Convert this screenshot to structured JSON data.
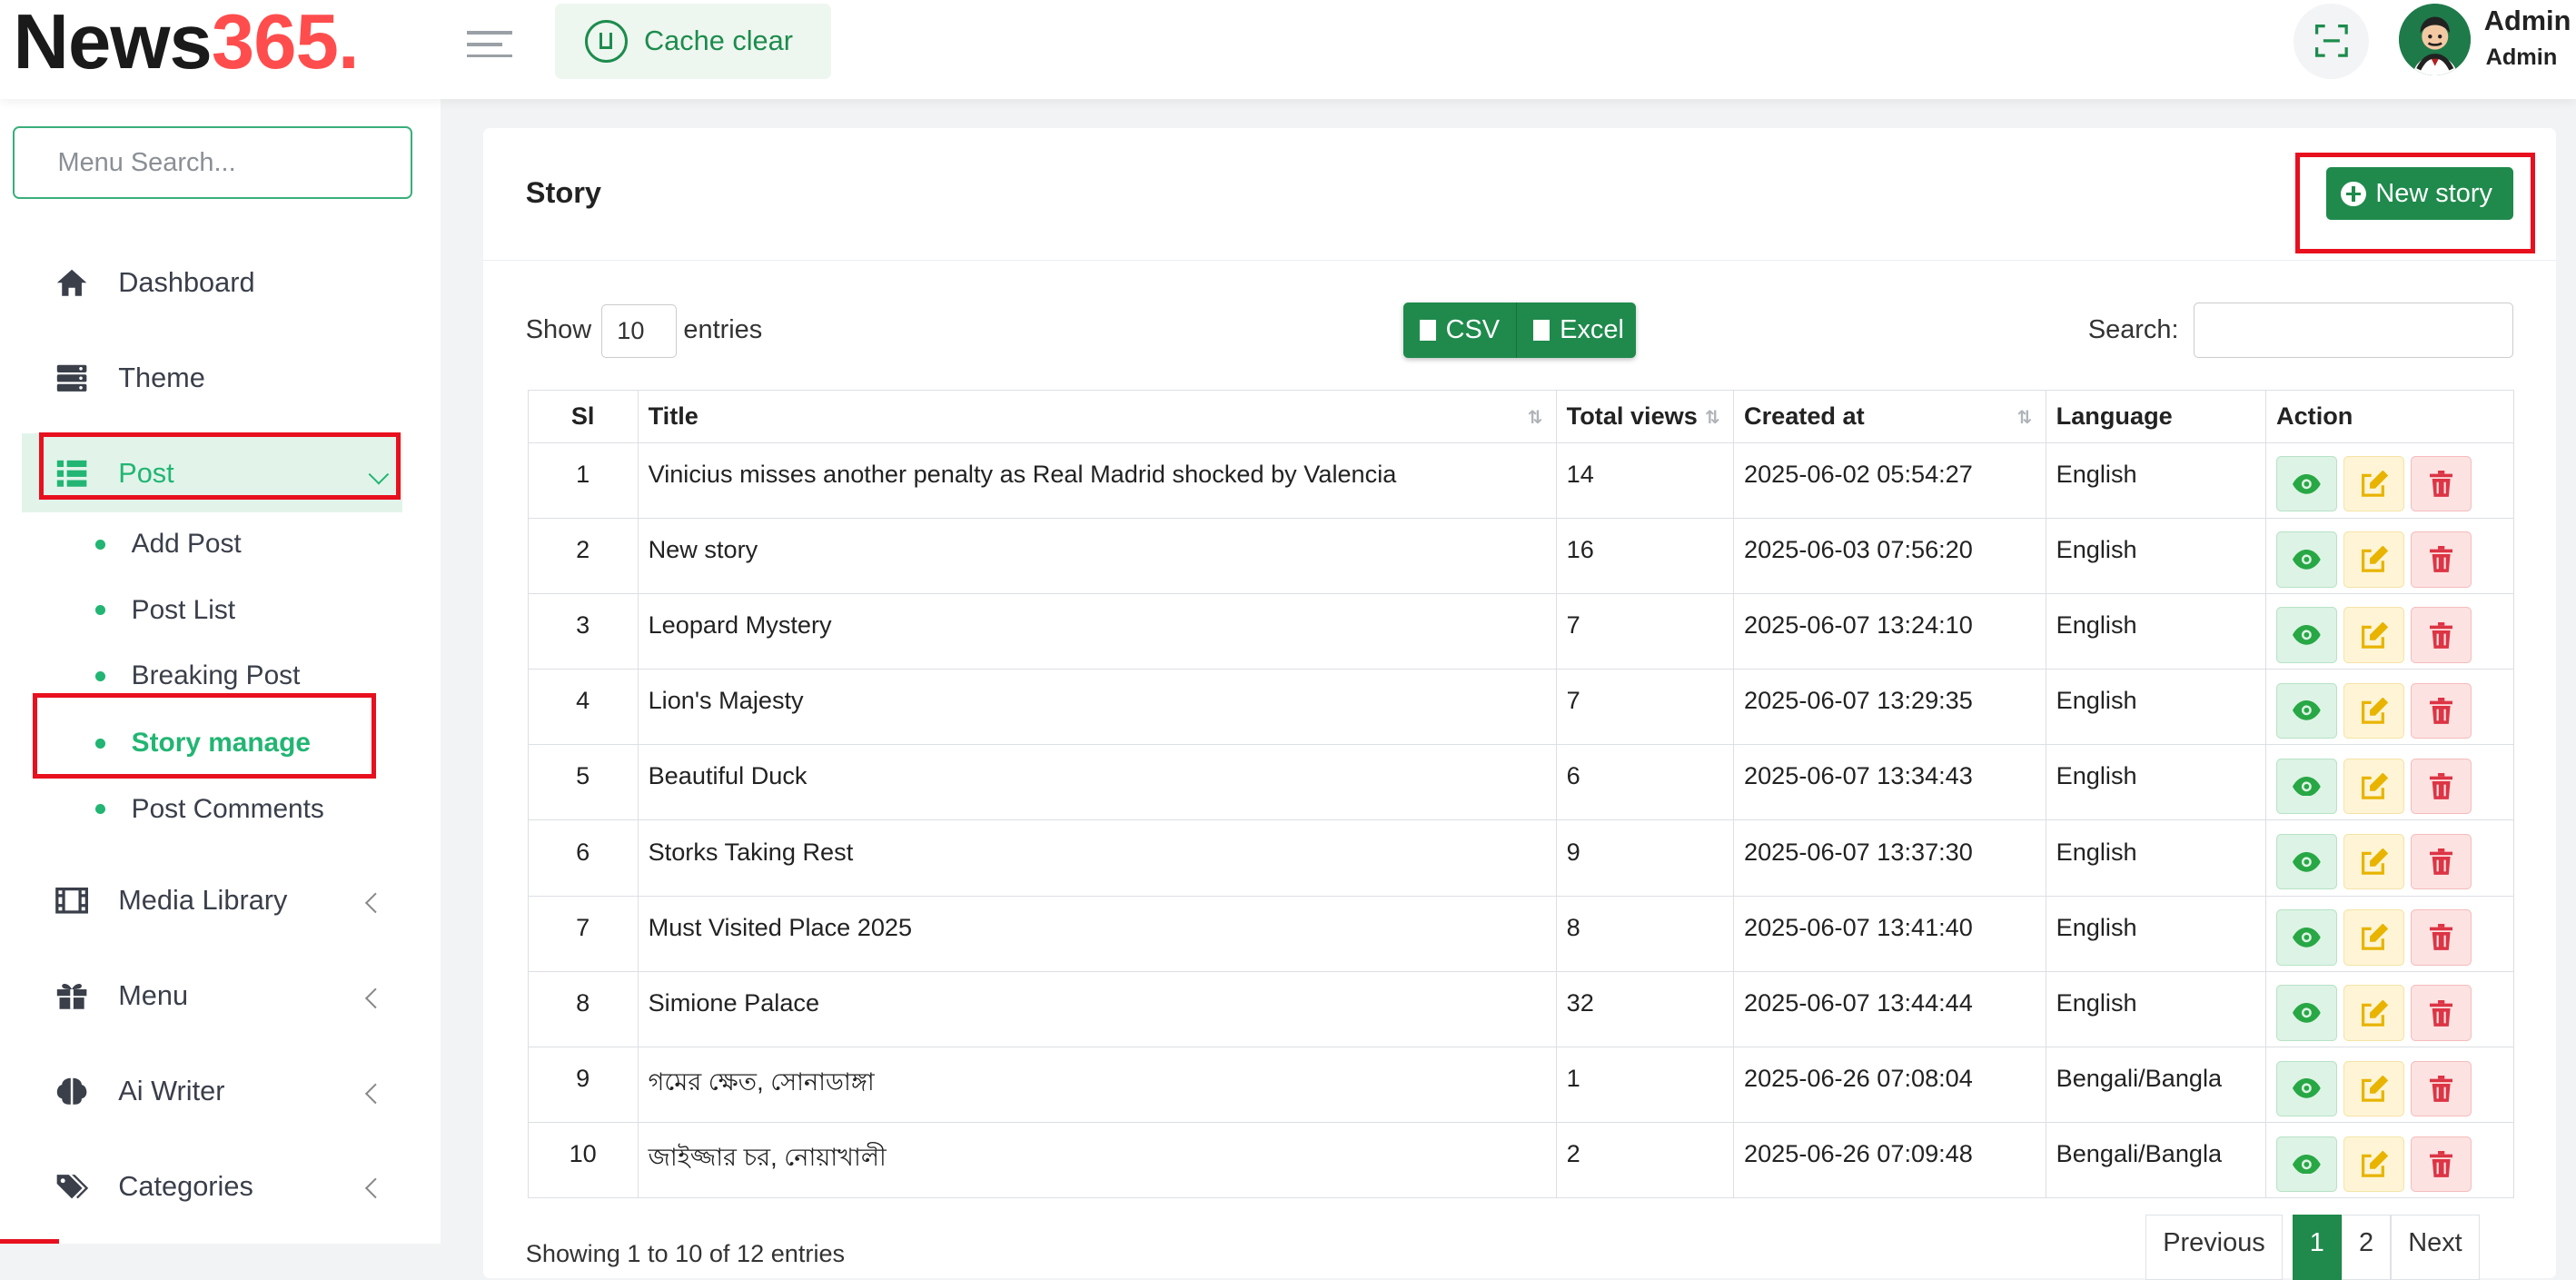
{
  "brand": {
    "part1": "News",
    "part2": "365."
  },
  "toolbar": {
    "cache_clear": "Cache clear"
  },
  "user": {
    "name": "Admin",
    "role": "Admin"
  },
  "sidebar": {
    "search_placeholder": "Menu Search...",
    "items": [
      {
        "label": "Dashboard",
        "icon": "home-icon"
      },
      {
        "label": "Theme",
        "icon": "server-icon"
      },
      {
        "label": "Post",
        "icon": "list-icon",
        "active": true
      },
      {
        "label": "Media Library",
        "icon": "film-icon"
      },
      {
        "label": "Menu",
        "icon": "gift-icon"
      },
      {
        "label": "Ai Writer",
        "icon": "brain-icon"
      },
      {
        "label": "Categories",
        "icon": "tags-icon"
      }
    ],
    "post_submenu": [
      {
        "label": "Add Post"
      },
      {
        "label": "Post List"
      },
      {
        "label": "Breaking Post"
      },
      {
        "label": "Story manage",
        "active": true
      },
      {
        "label": "Post Comments"
      }
    ]
  },
  "main": {
    "title": "Story",
    "new_button": "New story",
    "show_label": "Show",
    "entries_value": "10",
    "entries_label": "entries",
    "export": {
      "csv": "CSV",
      "excel": "Excel"
    },
    "search_label": "Search:",
    "columns": [
      "Sl",
      "Title",
      "Total views",
      "Created at",
      "Language",
      "Action"
    ],
    "rows": [
      {
        "sl": "1",
        "title": "Vinicius misses another penalty as Real Madrid shocked by Valencia",
        "views": "14",
        "created": "2025-06-02 05:54:27",
        "language": "English"
      },
      {
        "sl": "2",
        "title": "New story",
        "views": "16",
        "created": "2025-06-03 07:56:20",
        "language": "English"
      },
      {
        "sl": "3",
        "title": "Leopard Mystery",
        "views": "7",
        "created": "2025-06-07 13:24:10",
        "language": "English"
      },
      {
        "sl": "4",
        "title": "Lion's Majesty",
        "views": "7",
        "created": "2025-06-07 13:29:35",
        "language": "English"
      },
      {
        "sl": "5",
        "title": "Beautiful Duck",
        "views": "6",
        "created": "2025-06-07 13:34:43",
        "language": "English"
      },
      {
        "sl": "6",
        "title": "Storks Taking Rest",
        "views": "9",
        "created": "2025-06-07 13:37:30",
        "language": "English"
      },
      {
        "sl": "7",
        "title": "Must Visited Place 2025",
        "views": "8",
        "created": "2025-06-07 13:41:40",
        "language": "English"
      },
      {
        "sl": "8",
        "title": "Simione Palace",
        "views": "32",
        "created": "2025-06-07 13:44:44",
        "language": "English"
      },
      {
        "sl": "9",
        "title": "গমের ক্ষেত, সোনাডাঙ্গা",
        "views": "1",
        "created": "2025-06-26 07:08:04",
        "language": "Bengali/Bangla"
      },
      {
        "sl": "10",
        "title": "জাইজ্জার চর, নোয়াখালী",
        "views": "2",
        "created": "2025-06-26 07:09:48",
        "language": "Bengali/Bangla"
      }
    ],
    "footer": {
      "showing": "Showing 1 to 10 of 12 entries",
      "pagination": {
        "previous": "Previous",
        "pages": [
          "1",
          "2"
        ],
        "next": "Next",
        "current": "1"
      }
    }
  },
  "colors": {
    "brand_dark": "#1a1a1a",
    "brand_red": "#ff4d4d",
    "primary_green": "#1f8a4c",
    "active_green": "#22b573",
    "highlight_red": "#e8101e"
  }
}
